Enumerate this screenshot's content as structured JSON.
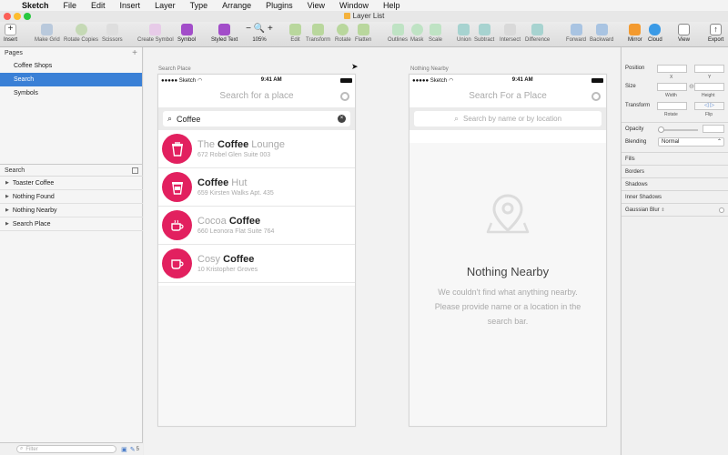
{
  "menubar": {
    "app": "Sketch",
    "items": [
      "File",
      "Edit",
      "Insert",
      "Layer",
      "Type",
      "Arrange",
      "Plugins",
      "View",
      "Window",
      "Help"
    ]
  },
  "window": {
    "title": "Layer List"
  },
  "toolbar": {
    "insert": "Insert",
    "make_grid": "Make Grid",
    "rotate_copies": "Rotate Copies",
    "scissors": "Scissors",
    "create_symbol": "Create Symbol",
    "symbol": "Symbol",
    "styled_text": "Styled Text",
    "zoom": "105%",
    "edit": "Edit",
    "transform": "Transform",
    "rotate": "Rotate",
    "flatten": "Flatten",
    "outlines": "Outlines",
    "mask": "Mask",
    "scale": "Scale",
    "union": "Union",
    "subtract": "Subtract",
    "intersect": "Intersect",
    "difference": "Difference",
    "forward": "Forward",
    "backward": "Backward",
    "mirror": "Mirror",
    "cloud": "Cloud",
    "view": "View",
    "export": "Export"
  },
  "pages": {
    "header": "Pages",
    "items": [
      {
        "label": "Coffee Shops"
      },
      {
        "label": "Search"
      },
      {
        "label": "Symbols"
      }
    ]
  },
  "layers": {
    "header": "Search",
    "items": [
      {
        "label": "Toaster Coffee"
      },
      {
        "label": "Nothing Found"
      },
      {
        "label": "Nothing Nearby"
      },
      {
        "label": "Search Place"
      }
    ],
    "filter_placeholder": "Filter",
    "count": "5"
  },
  "artboard_search": {
    "label": "Search Place",
    "carrier": "●●●●● Sketch",
    "time": "9:41 AM",
    "nav_title": "Search for a place",
    "query": "Coffee",
    "results": [
      {
        "pre": "The ",
        "bold": "Coffee",
        "post": " Lounge",
        "address": "672 Robel Glen Suite 003"
      },
      {
        "pre": "",
        "bold": "Coffee",
        "post": " Hut",
        "address": "659 Kirsten Walks Apt. 435"
      },
      {
        "pre": "Cocoa ",
        "bold": "Coffee",
        "post": "",
        "address": "660 Leonora Flat Suite 764"
      },
      {
        "pre": "Cosy ",
        "bold": "Coffee",
        "post": "",
        "address": "10 Kristopher Groves"
      }
    ]
  },
  "artboard_nearby": {
    "label": "Nothing Nearby",
    "carrier": "●●●●● Sketch",
    "time": "9:41 AM",
    "nav_title": "Search For a Place",
    "search_placeholder": "Search by name or by location",
    "empty_title": "Nothing Nearby",
    "empty_body": "We couldn't find what anything nearby. Please provide name or a location in the search bar."
  },
  "inspector": {
    "position": "Position",
    "x": "X",
    "y": "Y",
    "size": "Size",
    "width": "Width",
    "height": "Height",
    "transform": "Transform",
    "rotate": "Rotate",
    "flip": "Flip",
    "opacity": "Opacity",
    "blending": "Blending",
    "blending_value": "Normal",
    "fills": "Fills",
    "borders": "Borders",
    "shadows": "Shadows",
    "inner_shadows": "Inner Shadows",
    "gaussian_blur": "Gaussian Blur"
  },
  "colors": {
    "accent": "#e2205f",
    "selection": "#3a80d6"
  }
}
